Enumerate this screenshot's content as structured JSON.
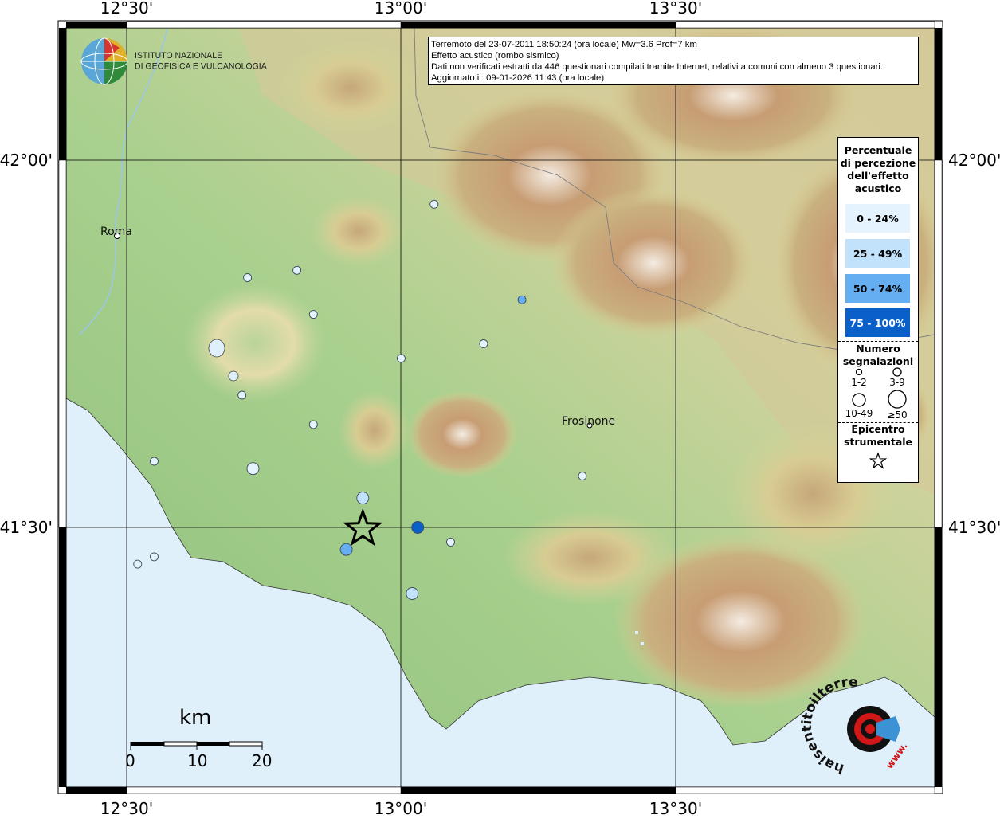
{
  "map": {
    "graticule": {
      "top_labels": [
        "12°30'",
        "13°00'",
        "13°30'"
      ],
      "bottom_labels": [
        "12°30'",
        "13°00'",
        "13°30'"
      ],
      "left_labels": [
        "42°00'",
        "41°30'"
      ],
      "right_labels": [
        "42°00'",
        "41°30'"
      ]
    },
    "cities": [
      {
        "name": "Roma"
      },
      {
        "name": "Frosinone"
      }
    ],
    "points": [
      {
        "lon": 13.06,
        "lat": 41.94,
        "class": "0-24",
        "size": "3-9"
      },
      {
        "lon": 12.81,
        "lat": 41.85,
        "class": "0-24",
        "size": "3-9"
      },
      {
        "lon": 12.72,
        "lat": 41.84,
        "class": "0-24",
        "size": "3-9"
      },
      {
        "lon": 13.22,
        "lat": 41.81,
        "class": "50-74",
        "size": "3-9"
      },
      {
        "lon": 12.84,
        "lat": 41.79,
        "class": "0-24",
        "size": "3-9"
      },
      {
        "lon": 13.15,
        "lat": 41.75,
        "class": "0-24",
        "size": "3-9"
      },
      {
        "lon": 13.0,
        "lat": 41.73,
        "class": "0-24",
        "size": "3-9"
      },
      {
        "lon": 12.71,
        "lat": 41.68,
        "class": "0-24",
        "size": "3-9"
      },
      {
        "lon": 12.84,
        "lat": 41.64,
        "class": "0-24",
        "size": "3-9"
      },
      {
        "lon": 12.55,
        "lat": 41.59,
        "class": "0-24",
        "size": "3-9"
      },
      {
        "lon": 12.73,
        "lat": 41.58,
        "class": "0-24",
        "size": "10-49"
      },
      {
        "lon": 13.33,
        "lat": 41.57,
        "class": "0-24",
        "size": "3-9"
      },
      {
        "lon": 12.93,
        "lat": 41.54,
        "class": "25-49",
        "size": "10-49"
      },
      {
        "lon": 13.03,
        "lat": 41.5,
        "class": "75-100",
        "size": "10-49"
      },
      {
        "lon": 13.09,
        "lat": 41.48,
        "class": "0-24",
        "size": "3-9"
      },
      {
        "lon": 12.9,
        "lat": 41.47,
        "class": "50-74",
        "size": "10-49"
      },
      {
        "lon": 12.55,
        "lat": 41.46,
        "class": "0-24",
        "size": "3-9"
      },
      {
        "lon": 12.52,
        "lat": 41.45,
        "class": "0-24",
        "size": "3-9"
      },
      {
        "lon": 13.02,
        "lat": 41.41,
        "class": "25-49",
        "size": "10-49"
      }
    ],
    "epicenter": {
      "lon": 12.93,
      "lat": 41.5
    }
  },
  "info": {
    "line1": "Terremoto del 23-07-2011 18:50:24 (ora locale) Mw=3.6 Prof=7 km",
    "line2": "Effetto acustico (rombo sismico)",
    "line3": "Dati non verificati estratti da 446 questionari compilati tramite Internet, relativi a comuni con almeno 3 questionari.",
    "line4": "Aggiornato il: 09-01-2026 11:43 (ora locale)"
  },
  "logo": {
    "line1": "ISTITUTO NAZIONALE",
    "line2": "DI GEOFISICA E VULCANOLOGIA"
  },
  "legend": {
    "title": "Percentuale di percezione dell'effetto acustico",
    "title_lines": [
      "Percentuale",
      "di percezione",
      "dell'effetto",
      "acustico"
    ],
    "classes": [
      {
        "label": "0 - 24%",
        "color": "#e4f3fd"
      },
      {
        "label": "25 - 49%",
        "color": "#c2e1fb"
      },
      {
        "label": "50 - 74%",
        "color": "#66aef2"
      },
      {
        "label": "75 - 100%",
        "color": "#0b5fc8"
      }
    ],
    "count_title_lines": [
      "Numero",
      "segnalazioni"
    ],
    "sizes": [
      "1-2",
      "3-9",
      "10-49",
      "≥50"
    ],
    "epicenter_title_lines": [
      "Epicentro",
      "strumentale"
    ]
  },
  "scalebar": {
    "unit": "km",
    "ticks": [
      "0",
      "10",
      "20"
    ]
  },
  "brand": {
    "text": "haisentitoilterremoto.it",
    "www": "www."
  },
  "colors": {
    "sea": "#dff0fb",
    "lowland": "#9cc98c",
    "hill": "#d9cf8e",
    "mountain": "#b8936a",
    "peak": "#f0e6dc"
  }
}
